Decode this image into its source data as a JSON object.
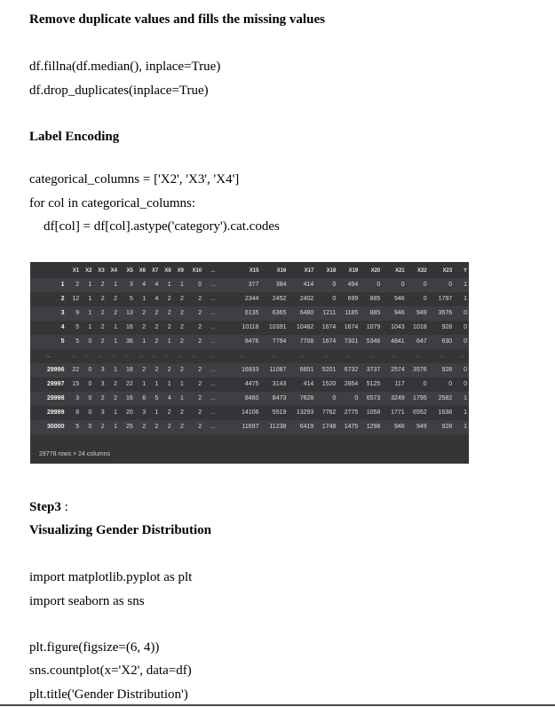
{
  "section1": {
    "heading": "Remove duplicate values and fills the missing values",
    "code": [
      "df.fillna(df.median(), inplace=True)",
      "df.drop_duplicates(inplace=True)"
    ]
  },
  "section2": {
    "heading": "Label Encoding",
    "code": [
      "categorical_columns = ['X2', 'X3', 'X4']",
      "for col in categorical_columns:",
      "df[col] = df[col].astype('category').cat.codes"
    ]
  },
  "dataframe": {
    "columns": [
      "",
      "X1",
      "X2",
      "X3",
      "X4",
      "X5",
      "X6",
      "X7",
      "X8",
      "X9",
      "X10",
      "...",
      "X15",
      "X16",
      "X17",
      "X18",
      "X19",
      "X20",
      "X21",
      "X22",
      "X23",
      "Y"
    ],
    "rows": [
      [
        "1",
        "2",
        "1",
        "2",
        "1",
        "3",
        "4",
        "4",
        "1",
        "1",
        "0",
        "...",
        "377",
        "384",
        "414",
        "0",
        "494",
        "0",
        "0",
        "0",
        "0",
        "1"
      ],
      [
        "2",
        "12",
        "1",
        "2",
        "2",
        "5",
        "1",
        "4",
        "2",
        "2",
        "2",
        "...",
        "2344",
        "2452",
        "2402",
        "0",
        "699",
        "885",
        "946",
        "0",
        "1797",
        "1"
      ],
      [
        "3",
        "9",
        "1",
        "2",
        "2",
        "13",
        "2",
        "2",
        "2",
        "2",
        "2",
        "...",
        "6135",
        "6365",
        "6480",
        "1211",
        "1185",
        "885",
        "946",
        "949",
        "3576",
        "0"
      ],
      [
        "4",
        "5",
        "1",
        "2",
        "1",
        "16",
        "2",
        "2",
        "2",
        "2",
        "2",
        "...",
        "10118",
        "10391",
        "10482",
        "1674",
        "1674",
        "1079",
        "1043",
        "1018",
        "928",
        "0"
      ],
      [
        "5",
        "5",
        "0",
        "2",
        "1",
        "36",
        "1",
        "2",
        "1",
        "2",
        "2",
        "...",
        "8476",
        "7794",
        "7708",
        "1674",
        "7301",
        "5346",
        "4841",
        "647",
        "630",
        "0"
      ],
      [
        "...",
        "...",
        "...",
        "...",
        "...",
        "...",
        "...",
        "...",
        "...",
        "...",
        "...",
        "...",
        "...",
        "...",
        "...",
        "...",
        "...",
        "...",
        "...",
        "...",
        "...",
        "..."
      ],
      [
        "29996",
        "22",
        "0",
        "3",
        "1",
        "18",
        "2",
        "2",
        "2",
        "2",
        "2",
        "...",
        "16933",
        "11087",
        "6601",
        "5201",
        "6732",
        "3737",
        "2574",
        "3576",
        "928",
        "0"
      ],
      [
        "29997",
        "15",
        "0",
        "3",
        "2",
        "22",
        "1",
        "1",
        "1",
        "1",
        "2",
        "...",
        "4475",
        "3143",
        "414",
        "1520",
        "2854",
        "5125",
        "117",
        "0",
        "0",
        "0"
      ],
      [
        "29998",
        "3",
        "0",
        "2",
        "2",
        "16",
        "6",
        "5",
        "4",
        "1",
        "2",
        "...",
        "8460",
        "8473",
        "7628",
        "0",
        "0",
        "6573",
        "3249",
        "1795",
        "2582",
        "1"
      ],
      [
        "29999",
        "8",
        "0",
        "3",
        "1",
        "20",
        "3",
        "1",
        "2",
        "2",
        "2",
        "...",
        "14106",
        "5519",
        "13293",
        "7762",
        "2775",
        "1058",
        "1771",
        "6552",
        "1638",
        "1"
      ],
      [
        "30000",
        "5",
        "0",
        "2",
        "1",
        "25",
        "2",
        "2",
        "2",
        "2",
        "2",
        "...",
        "11697",
        "11238",
        "6419",
        "1748",
        "1475",
        "1298",
        "946",
        "949",
        "928",
        "1"
      ]
    ],
    "footer": "29778 rows × 24 columns"
  },
  "section3": {
    "step_label": "Step3",
    "step_suffix": " :",
    "heading": "Visualizing Gender Distribution",
    "imports": [
      "import matplotlib.pyplot as plt",
      "import seaborn as sns"
    ],
    "code": [
      "plt.figure(figsize=(6, 4))",
      "sns.countplot(x='X2', data=df)",
      "plt.title('Gender Distribution')"
    ]
  }
}
